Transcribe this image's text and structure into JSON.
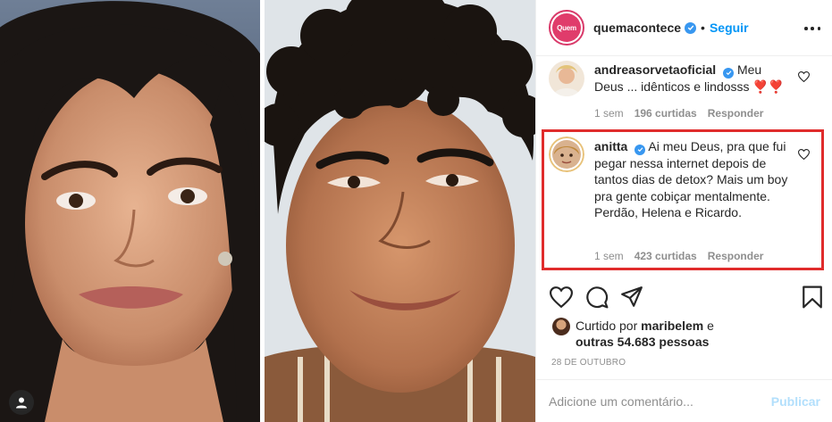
{
  "post": {
    "author": {
      "username": "quemacontece",
      "avatar_text": "Quem",
      "verified": true,
      "follow_label": "Seguir",
      "separator": "•"
    },
    "comments": [
      {
        "username": "andreasorvetaoficial",
        "verified": true,
        "text": "Meu Deus ... idênticos e lindosss ❣️❣️",
        "age": "1 sem",
        "likes": "196 curtidas",
        "reply_label": "Responder"
      },
      {
        "username": "anitta",
        "verified": true,
        "text": "Ai meu Deus, pra que fui pegar nessa internet depois de tantos dias de detox? Mais um boy pra gente cobiçar mentalmente. Perdão, Helena e Ricardo.",
        "age": "1 sem",
        "likes": "423 curtidas",
        "reply_label": "Responder"
      }
    ],
    "liked_by": {
      "prefix": "Curtido por",
      "user": "maribelem",
      "connector": "e",
      "others": "outras 54.683 pessoas"
    },
    "date": "28 DE OUTUBRO",
    "add_comment_placeholder": "Adicione um comentário...",
    "post_label": "Publicar"
  },
  "icons": {
    "like": "heart-icon",
    "comment": "comment-icon",
    "share": "share-icon",
    "save": "bookmark-icon",
    "more": "more-options-icon",
    "verified": "verified-badge-icon"
  },
  "colors": {
    "link_blue": "#0095f6",
    "verified_blue": "#3897f0",
    "highlight_red": "#e02c2c",
    "muted_text": "#8e8e8e",
    "post_disabled": "#b2dffc"
  }
}
